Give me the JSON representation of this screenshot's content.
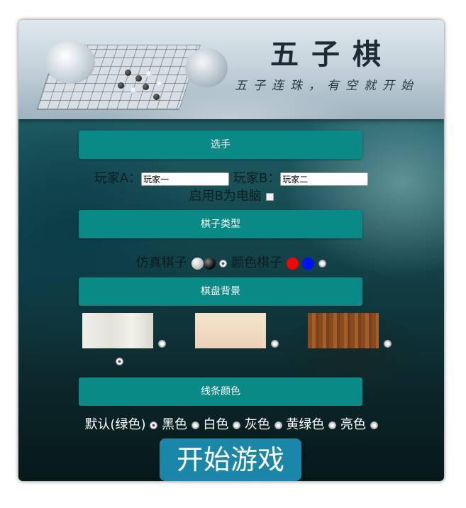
{
  "banner": {
    "title": "五子棋",
    "subtitle": "五子连珠，有空就开始"
  },
  "sections": {
    "players": "选手",
    "piece_type": "棋子类型",
    "board_bg": "棋盘背景",
    "line_color": "线条颜色"
  },
  "players": {
    "a_label": "玩家A：",
    "a_value": "玩家一",
    "b_label": "玩家B：",
    "b_value": "玩家二",
    "computer_label": "启用B为电脑"
  },
  "piece_type": {
    "realistic_label": "仿真棋子",
    "color_label": "颜色棋子",
    "selected": "realistic"
  },
  "line_colors": {
    "options": [
      "默认(绿色)",
      "黑色",
      "白色",
      "灰色",
      "黄绿色",
      "亮色"
    ],
    "selected_index": 0
  },
  "start_button": "开始游戏",
  "colors": {
    "section_bar": "#0a8a86",
    "start_button": "#1a86a9"
  }
}
